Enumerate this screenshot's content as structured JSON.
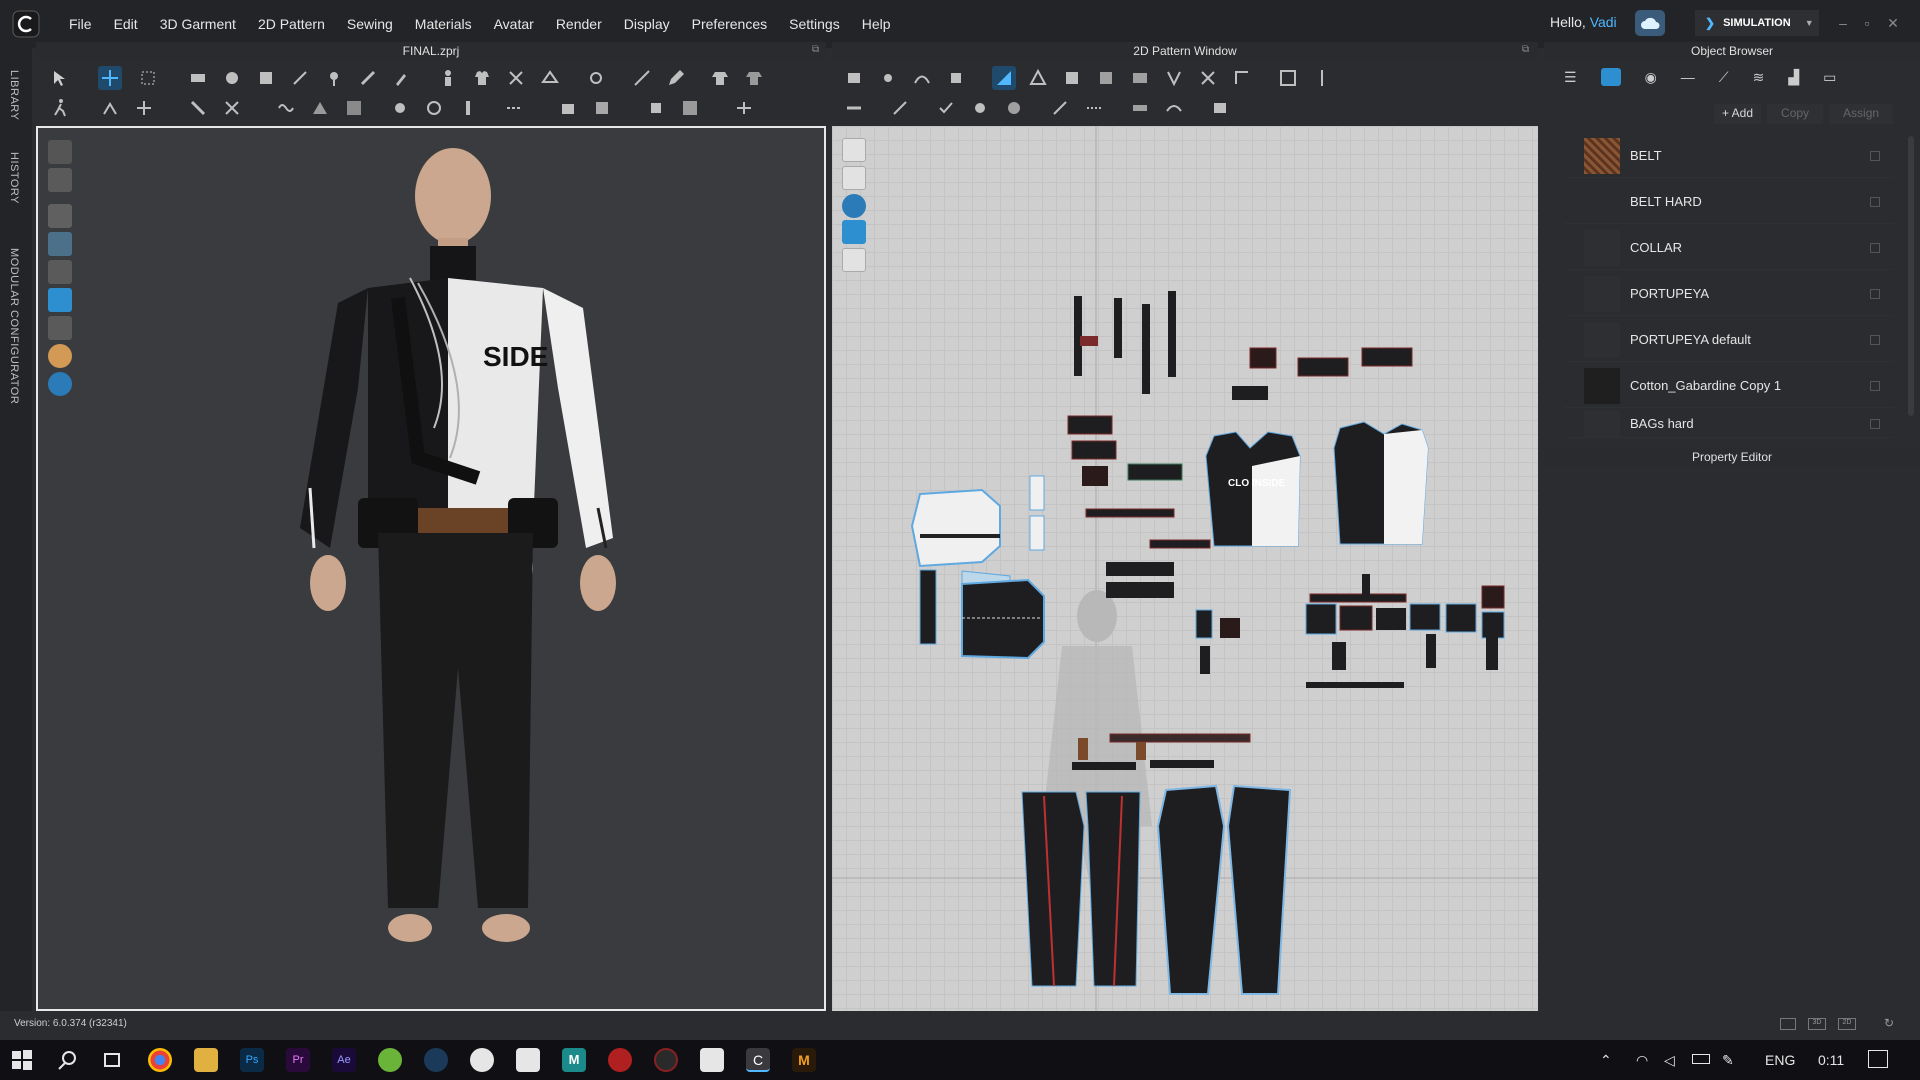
{
  "menubar": {
    "items": [
      "File",
      "Edit",
      "3D Garment",
      "2D Pattern",
      "Sewing",
      "Materials",
      "Avatar",
      "Render",
      "Display",
      "Preferences",
      "Settings",
      "Help"
    ],
    "greeting_prefix": "Hello, ",
    "user_name": "Vadi",
    "simulation_label": "SIMULATION"
  },
  "left_rail": {
    "tabs": [
      "LIBRARY",
      "HISTORY",
      "MODULAR CONFIGURATOR"
    ]
  },
  "viewport3d": {
    "title": "FINAL.zprj",
    "shirt_print": "SIDE"
  },
  "viewport2d": {
    "title": "2D Pattern Window",
    "front_print": "CLO INSIDE"
  },
  "object_browser": {
    "title": "Object Browser",
    "add_label": "+ Add",
    "copy_label": "Copy",
    "assign_label": "Assign",
    "items": [
      {
        "label": "BELT",
        "swatch": "#7a4a2a"
      },
      {
        "label": "BELT HARD",
        "swatch": ""
      },
      {
        "label": "COLLAR",
        "swatch": "#2a2b2d"
      },
      {
        "label": "PORTUPEYA",
        "swatch": "#2a2b2d"
      },
      {
        "label": "PORTUPEYA default",
        "swatch": "#2a2b2d"
      },
      {
        "label": "Cotton_Gabardine Copy 1",
        "swatch": "#1f1f20"
      },
      {
        "label": "BAGs hard",
        "swatch": "#2a2b2d"
      }
    ]
  },
  "property_editor": {
    "title": "Property Editor"
  },
  "status": {
    "version": "Version: 6.0.374 (r32341)"
  },
  "taskbar": {
    "language": "ENG",
    "time": "0:11"
  },
  "colors": {
    "accent": "#4fb8ff",
    "viewport_bg": "#3a3b3e",
    "pattern_bg": "#cfcfcf"
  }
}
